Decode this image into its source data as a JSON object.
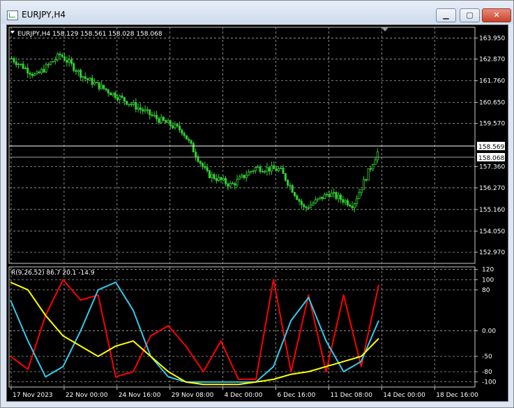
{
  "window": {
    "title": "EURJPY,H4",
    "min_label": "▁",
    "max_label": "▢",
    "close_label": "✕"
  },
  "main_chart": {
    "header": "EURJPY,H4  158.129 158.561 158.028 158.068",
    "price_labels": [
      "163.950",
      "162.870",
      "161.760",
      "160.650",
      "159.570",
      "157.360",
      "156.270",
      "155.160",
      "154.050",
      "152.970"
    ],
    "bid_label": "158.569",
    "last_label": "158.068"
  },
  "indicator": {
    "header": "R(9,26,52) 86.7 20.1 -14.9",
    "levels": [
      "120",
      "100",
      "80",
      "0.00",
      "-50",
      "-80",
      "-100"
    ]
  },
  "time_labels": [
    "17 Nov 2023",
    "22 Nov 00:00",
    "24 Nov 16:00",
    "29 Nov 08:00",
    "4 Dec 00:00",
    "6 Dec 16:00",
    "11 Dec 08:00",
    "14 Dec 00:00",
    "18 Dec 16:00"
  ],
  "colors": {
    "candles": "#33cc33",
    "grid": "#bfbfbf",
    "red": "#ff0000",
    "cyan": "#33ccee",
    "yellow": "#ffff00"
  },
  "chart_data": [
    {
      "type": "line",
      "title": "EURJPY,H4",
      "x": [
        "17 Nov 2023",
        "22 Nov 00:00",
        "24 Nov 16:00",
        "29 Nov 08:00",
        "4 Dec 00:00",
        "6 Dec 16:00",
        "11 Dec 08:00",
        "14 Dec 00:00",
        "18 Dec 16:00"
      ],
      "ylim": [
        152.4,
        164.5
      ],
      "series": [
        {
          "values": [
            162.9,
            162.0,
            163.1,
            161.9,
            161.2,
            160.5,
            159.8,
            159.2,
            157.0,
            156.4,
            157.3,
            157.2,
            155.2,
            156.0,
            155.4,
            158.1
          ]
        }
      ]
    },
    {
      "type": "line",
      "title": "R(9,26,52)",
      "ylim": [
        -110,
        125
      ],
      "series": [
        {
          "values": [
            -50,
            -75,
            30,
            100,
            60,
            70,
            -90,
            -80,
            -10,
            10,
            -30,
            -80,
            -20,
            -95,
            -95,
            100,
            -80,
            70,
            -80,
            70,
            -70,
            90
          ]
        },
        {
          "values": [
            60,
            -20,
            -90,
            -70,
            0,
            80,
            95,
            40,
            -50,
            -90,
            -100,
            -100,
            -100,
            -100,
            -100,
            -70,
            20,
            65,
            -20,
            -80,
            -60,
            20
          ]
        },
        {
          "values": [
            95,
            80,
            30,
            -10,
            -30,
            -50,
            -30,
            -20,
            -50,
            -80,
            -100,
            -105,
            -105,
            -105,
            -100,
            -95,
            -85,
            -80,
            -70,
            -60,
            -50,
            -15
          ]
        }
      ]
    }
  ]
}
